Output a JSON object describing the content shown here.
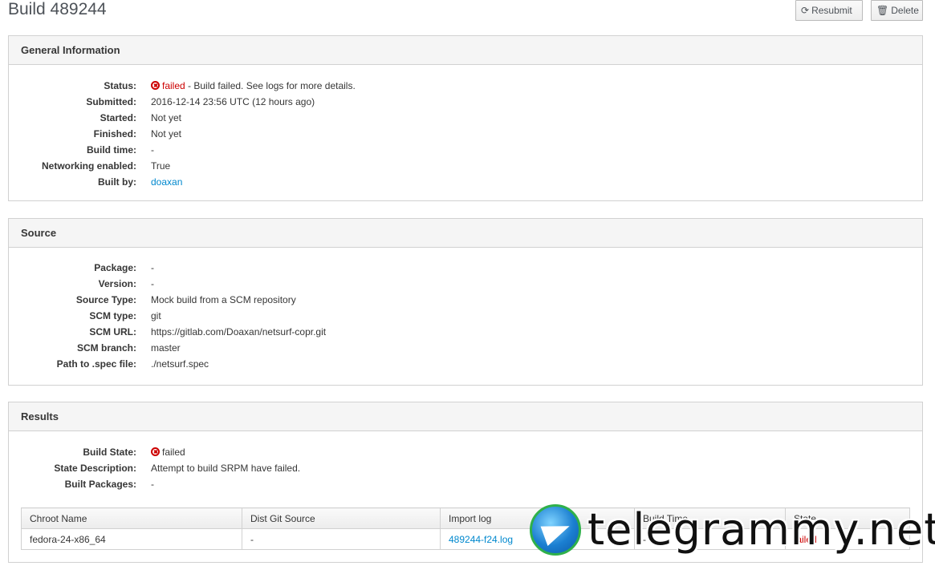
{
  "page": {
    "title": "Build 489244"
  },
  "buttons": {
    "resubmit": "Resubmit",
    "delete": "Delete"
  },
  "general": {
    "heading": "General Information",
    "rows": [
      {
        "label": "Status:",
        "status": "failed",
        "value": " - Build failed. See logs for more details."
      },
      {
        "label": "Submitted:",
        "value": "2016-12-14 23:56 UTC (12 hours ago)"
      },
      {
        "label": "Started:",
        "value": "Not yet"
      },
      {
        "label": "Finished:",
        "value": "Not yet"
      },
      {
        "label": "Build time:",
        "value": "-"
      },
      {
        "label": "Networking enabled:",
        "value": "True"
      },
      {
        "label": "Built by:",
        "value": "doaxan"
      }
    ]
  },
  "source": {
    "heading": "Source",
    "rows": [
      {
        "label": "Package:",
        "value": "-"
      },
      {
        "label": "Version:",
        "value": "-"
      },
      {
        "label": "Source Type:",
        "value": "Mock build from a SCM repository"
      },
      {
        "label": "SCM type:",
        "value": "git"
      },
      {
        "label": "SCM URL:",
        "value": "https://gitlab.com/Doaxan/netsurf-copr.git"
      },
      {
        "label": "SCM branch:",
        "value": "master"
      },
      {
        "label": "Path to .spec file:",
        "value": "./netsurf.spec"
      }
    ]
  },
  "results": {
    "heading": "Results",
    "rows": [
      {
        "label": "Build State:",
        "status": "failed"
      },
      {
        "label": "State Description:",
        "value": "Attempt to build SRPM have failed."
      },
      {
        "label": "Built Packages:",
        "value": "-"
      }
    ],
    "table": {
      "headers": [
        "Chroot Name",
        "Dist Git Source",
        "Import log",
        "Build Time",
        "State"
      ],
      "rows": [
        {
          "chroot": "fedora-24-x86_64",
          "dist_git": "-",
          "import_log": "489244-f24.log",
          "build_time": "-",
          "state": "failed"
        }
      ]
    }
  },
  "watermark": {
    "text": "telegrammy.net"
  },
  "colors": {
    "failed": "#cc0000",
    "link": "#0088ce"
  }
}
